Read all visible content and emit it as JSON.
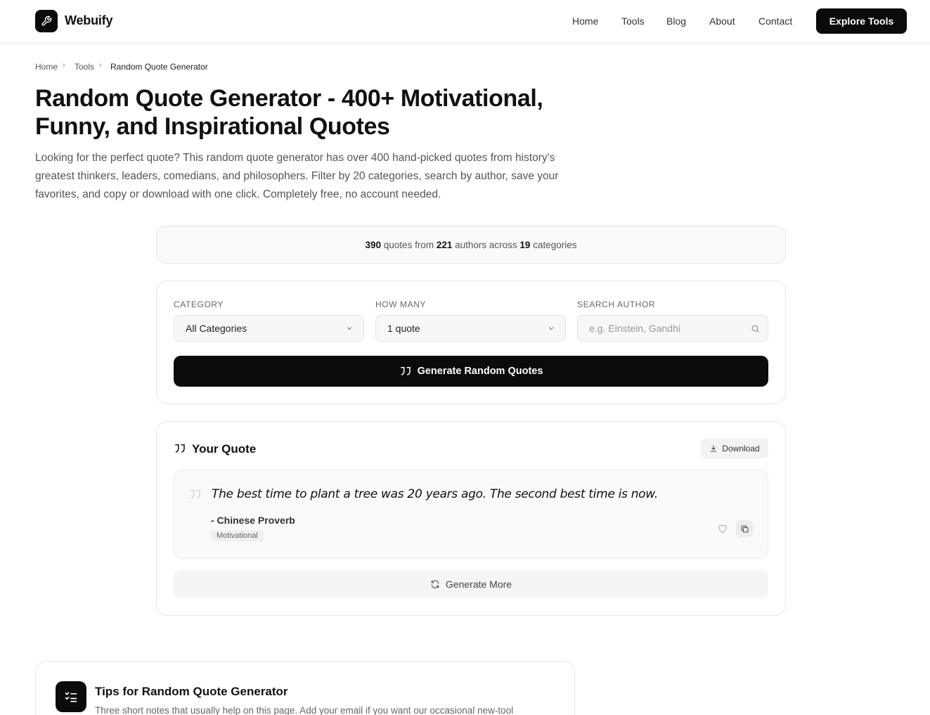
{
  "header": {
    "brand": "Webuify",
    "nav": [
      "Home",
      "Tools",
      "Blog",
      "About",
      "Contact"
    ],
    "cta": "Explore Tools"
  },
  "breadcrumb": [
    "Home",
    "Tools",
    "Random Quote Generator"
  ],
  "page": {
    "title_line1": "Random Quote Generator - 400+ Motivational,",
    "title_line2": "Funny, and Inspirational Quotes",
    "intro_line1": "Looking for the perfect quote? This random quote generator has over 400 hand-picked quotes from history's",
    "intro_line2": "greatest thinkers, leaders, comedians, and philosophers. Filter by 20 categories, search by author, save your",
    "intro_line3": "favorites, and copy or download with one click. Completely free, no account needed."
  },
  "stats": {
    "quotes": "390",
    "quotes_label": " quotes from ",
    "authors": "221",
    "authors_label": " authors across ",
    "categories": "19",
    "categories_label": " categories"
  },
  "controls": {
    "category_label": "CATEGORY",
    "category_value": "All Categories",
    "count_label": "HOW MANY",
    "count_value": "1 quote",
    "search_label": "SEARCH AUTHOR",
    "search_placeholder": "e.g. Einstein, Gandhi",
    "generate_label": "Generate Random Quotes"
  },
  "result": {
    "heading": "Your Quote",
    "download_label": "Download",
    "quote_text": "The best time to plant a tree was 20 years ago. The second best time is now.",
    "quote_author": "- Chinese Proverb",
    "quote_category": "Motivational",
    "more_label": "Generate More"
  },
  "tips": {
    "title": "Tips for Random Quote Generator",
    "subtitle": "Three short notes that usually help on this page. Add your email if you want our occasional new-tool"
  }
}
